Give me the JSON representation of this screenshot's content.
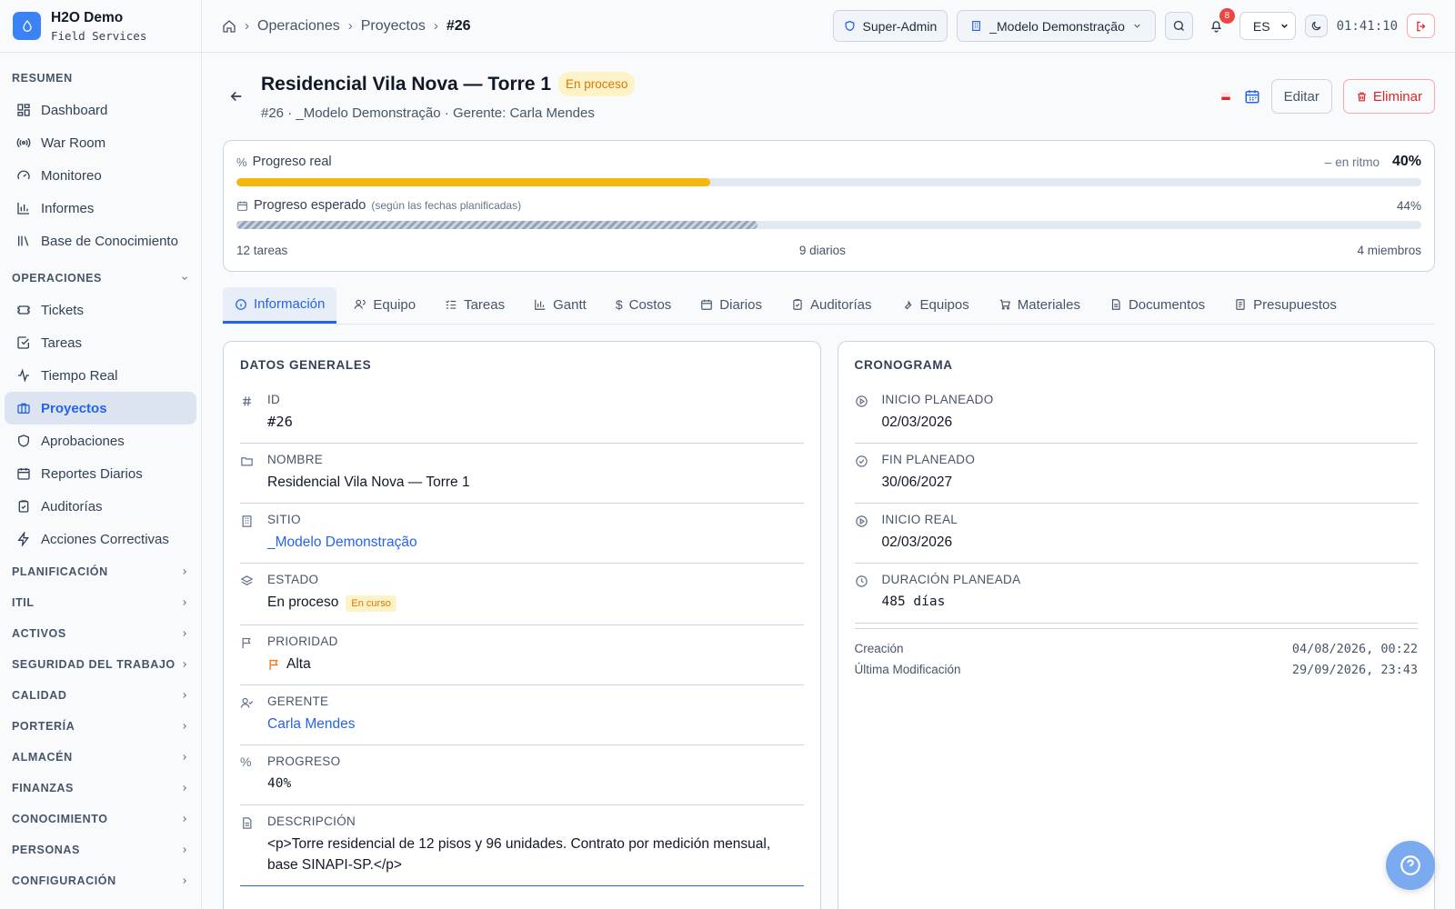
{
  "brand": {
    "name": "H2O Demo",
    "sub": "Field Services"
  },
  "sidebar": {
    "resumen_label": "RESUMEN",
    "resumen": [
      {
        "label": "Dashboard"
      },
      {
        "label": "War Room"
      },
      {
        "label": "Monitoreo"
      },
      {
        "label": "Informes"
      },
      {
        "label": "Base de Conocimiento"
      }
    ],
    "operaciones_label": "OPERACIONES",
    "operaciones": [
      {
        "label": "Tickets"
      },
      {
        "label": "Tareas"
      },
      {
        "label": "Tiempo Real"
      },
      {
        "label": "Proyectos"
      },
      {
        "label": "Aprobaciones"
      },
      {
        "label": "Reportes Diarios"
      },
      {
        "label": "Auditorías"
      },
      {
        "label": "Acciones Correctivas"
      }
    ],
    "groups": [
      "PLANIFICACIÓN",
      "ITIL",
      "ACTIVOS",
      "SEGURIDAD DEL TRABAJO",
      "CALIDAD",
      "PORTERÍA",
      "ALMACÉN",
      "FINANZAS",
      "CONOCIMIENTO",
      "PERSONAS",
      "CONFIGURACIÓN"
    ]
  },
  "breadcrumb": {
    "items": [
      "Operaciones",
      "Proyectos"
    ],
    "current": "#26"
  },
  "topbar": {
    "role": "Super-Admin",
    "tenant": "_Modelo Demonstração",
    "notifications": "8",
    "language": "ES",
    "clock": "01:41:10"
  },
  "project": {
    "title": "Residencial Vila Nova — Torre 1",
    "status": "En proceso",
    "subtitle": "#26 · _Modelo Demonstração · Gerente: Carla Mendes",
    "edit_label": "Editar",
    "delete_label": "Eliminar"
  },
  "progress": {
    "real_label": "Progreso real",
    "pace_label": "en ritmo",
    "real_value": "40%",
    "real_fraction": 0.4,
    "expected_label": "Progreso esperado",
    "expected_note": "(según las fechas planificadas)",
    "expected_value": "44%",
    "expected_fraction": 0.44,
    "tasks": "12 tareas",
    "diaries": "9 diarios",
    "members": "4 miembros"
  },
  "tabs": [
    "Información",
    "Equipo",
    "Tareas",
    "Gantt",
    "Costos",
    "Diarios",
    "Auditorías",
    "Equipos",
    "Materiales",
    "Documentos",
    "Presupuestos"
  ],
  "general": {
    "header": "DATOS GENERALES",
    "id_label": "ID",
    "id": "#26",
    "name_label": "NOMBRE",
    "name": "Residencial Vila Nova — Torre 1",
    "site_label": "SITIO",
    "site": "_Modelo Demonstração",
    "state_label": "ESTADO",
    "state": "En proceso",
    "state_badge": "En curso",
    "priority_label": "PRIORIDAD",
    "priority": "Alta",
    "manager_label": "GERENTE",
    "manager": "Carla Mendes",
    "progress_label": "PROGRESO",
    "progress": "40%",
    "description_label": "DESCRIPCIÓN",
    "description": "<p>Torre residencial de 12 pisos y 96 unidades. Contrato por medición mensual, base SINAPI-SP.</p>"
  },
  "schedule": {
    "header": "CRONOGRAMA",
    "planned_start_label": "INICIO PLANEADO",
    "planned_start": "02/03/2026",
    "planned_end_label": "FIN PLANEADO",
    "planned_end": "30/06/2027",
    "real_start_label": "INICIO REAL",
    "real_start": "02/03/2026",
    "duration_label": "DURACIÓN PLANEADA",
    "duration": "485 días",
    "created_label": "Creación",
    "created": "04/08/2026, 00:22",
    "modified_label": "Última Modificación",
    "modified": "29/09/2026, 23:43"
  },
  "colors": {
    "accent": "#2563eb",
    "progress_bar": "#f5b70b",
    "status_bg": "#fef3c7",
    "status_fg": "#d97706",
    "danger": "#dc2626"
  }
}
